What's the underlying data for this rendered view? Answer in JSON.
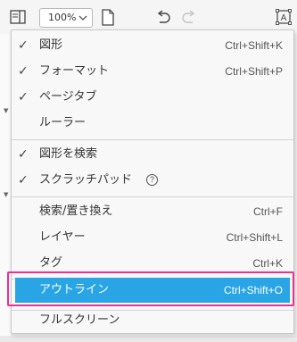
{
  "toolbar": {
    "zoom_value": "100%",
    "icons": [
      "panel-toggle-icon",
      "chevron-down-icon",
      "page-icon",
      "undo-icon",
      "redo-icon",
      "text-format-icon"
    ],
    "text_icon_glyph": "A"
  },
  "menu": {
    "items": [
      {
        "label": "図形",
        "shortcut": "Ctrl+Shift+K",
        "checked": true
      },
      {
        "label": "フォーマット",
        "shortcut": "Ctrl+Shift+P",
        "checked": true
      },
      {
        "label": "ページタブ",
        "shortcut": "",
        "checked": true
      },
      {
        "label": "ルーラー",
        "shortcut": "",
        "checked": false
      },
      {
        "label": "図形を検索",
        "shortcut": "",
        "checked": true
      },
      {
        "label": "スクラッチパッド",
        "shortcut": "",
        "checked": true,
        "help": "?"
      },
      {
        "label": "検索/置き換え",
        "shortcut": "Ctrl+F",
        "checked": false
      },
      {
        "label": "レイヤー",
        "shortcut": "Ctrl+Shift+L",
        "checked": false
      },
      {
        "label": "タグ",
        "shortcut": "Ctrl+K",
        "checked": false
      },
      {
        "label": "アウトライン",
        "shortcut": "Ctrl+Shift+O",
        "checked": false,
        "selected": true
      },
      {
        "label": "フルスクリーン",
        "shortcut": "",
        "checked": false
      }
    ],
    "check_glyph": "✓"
  },
  "colors": {
    "selected_bg": "#29a4e4",
    "highlight_border": "#e9328f"
  }
}
